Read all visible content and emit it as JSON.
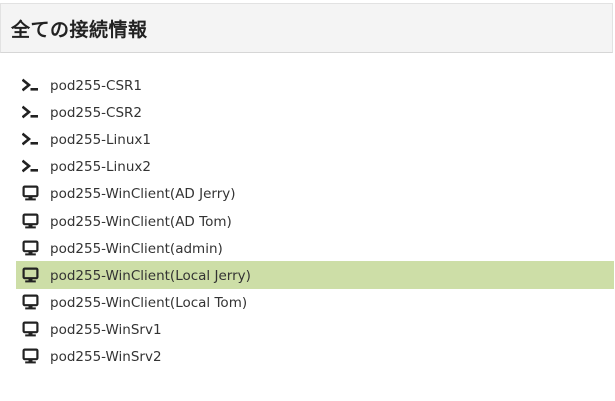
{
  "header": {
    "title": "全ての接続情報"
  },
  "connections": [
    {
      "label": "pod255-CSR1",
      "icon": "terminal-icon",
      "selected": false
    },
    {
      "label": "pod255-CSR2",
      "icon": "terminal-icon",
      "selected": false
    },
    {
      "label": "pod255-Linux1",
      "icon": "terminal-icon",
      "selected": false
    },
    {
      "label": "pod255-Linux2",
      "icon": "terminal-icon",
      "selected": false
    },
    {
      "label": "pod255-WinClient(AD Jerry)",
      "icon": "monitor-icon",
      "selected": false
    },
    {
      "label": "pod255-WinClient(AD Tom)",
      "icon": "monitor-icon",
      "selected": false
    },
    {
      "label": "pod255-WinClient(admin)",
      "icon": "monitor-icon",
      "selected": false
    },
    {
      "label": "pod255-WinClient(Local Jerry)",
      "icon": "monitor-icon",
      "selected": true
    },
    {
      "label": "pod255-WinClient(Local Tom)",
      "icon": "monitor-icon",
      "selected": false
    },
    {
      "label": "pod255-WinSrv1",
      "icon": "monitor-icon",
      "selected": false
    },
    {
      "label": "pod255-WinSrv2",
      "icon": "monitor-icon",
      "selected": false
    }
  ],
  "colors": {
    "selected_row": "#cddea7",
    "header_bg": "#f4f4f4",
    "icon": "#222222"
  }
}
